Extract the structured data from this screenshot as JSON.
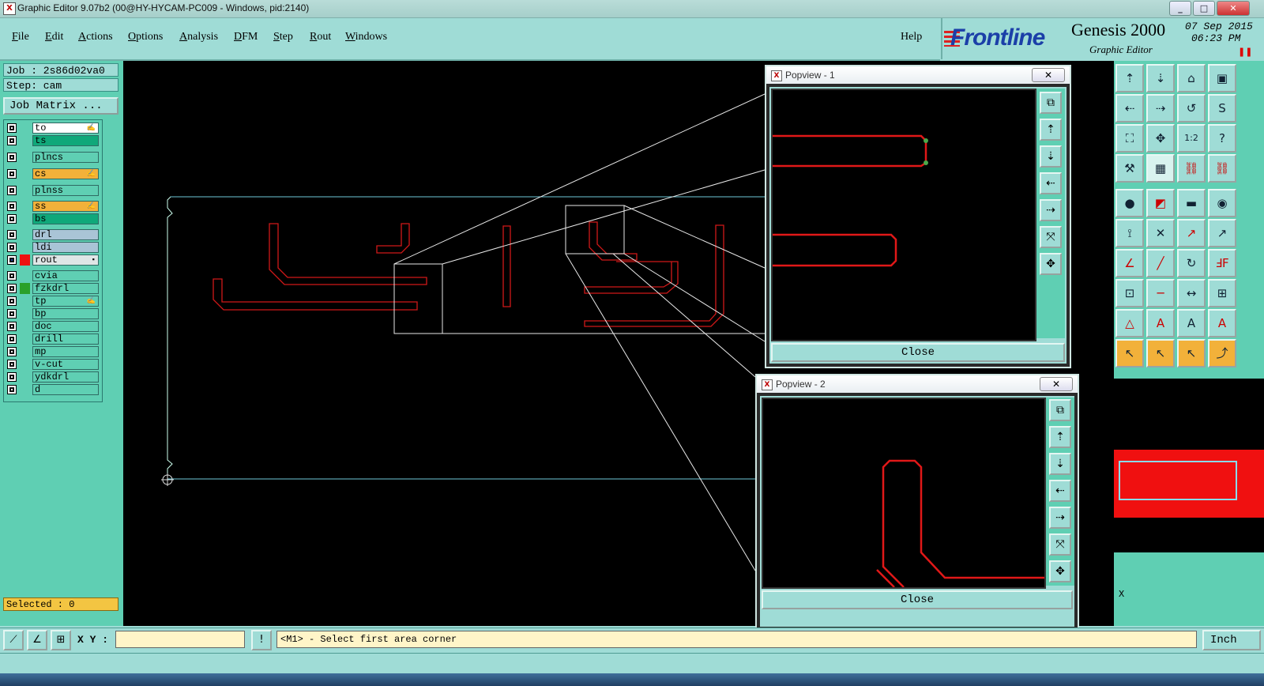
{
  "window": {
    "title": "Graphic Editor 9.07b2 (00@HY-HYCAM-PC009 - Windows, pid:2140)",
    "app_icon": "x-app-icon",
    "controls": [
      "minimize-icon",
      "maximize-icon",
      "close-icon"
    ]
  },
  "menubar": {
    "items": [
      "File",
      "Edit",
      "Actions",
      "Options",
      "Analysis",
      "DFM",
      "Step",
      "Rout",
      "Windows"
    ],
    "help": "Help"
  },
  "branding": {
    "logo": "Frontline",
    "product": "Genesis 2000",
    "subtitle": "Graphic Editor",
    "date": "07 Sep 2015",
    "time": "06:23 PM",
    "pause_icon": "pause-icon"
  },
  "left_panel": {
    "job": "Job : 2s86d02va0",
    "step": "Step: cam",
    "job_matrix": "Job Matrix ...",
    "layers": [
      {
        "name": "to",
        "color": "",
        "bg": "#ffffff",
        "mark": "✍"
      },
      {
        "name": "ts",
        "color": "",
        "bg": "#10a87a",
        "mark": ""
      },
      {
        "name": "plncs",
        "color": "",
        "bg": "#5fcfb3",
        "mark": ""
      },
      {
        "name": "cs",
        "color": "",
        "bg": "#f2b13a",
        "mark": "✍"
      },
      {
        "name": "plnss",
        "color": "",
        "bg": "#5fcfb3",
        "mark": ""
      },
      {
        "name": "ss",
        "color": "",
        "bg": "#f2b13a",
        "mark": "✍"
      },
      {
        "name": "bs",
        "color": "",
        "bg": "#10a87a",
        "mark": ""
      },
      {
        "name": "drl",
        "color": "",
        "bg": "#a9c4d6",
        "mark": ""
      },
      {
        "name": "ldi",
        "color": "",
        "bg": "#a9c4d6",
        "mark": ""
      },
      {
        "name": "rout",
        "color": "#ee1111",
        "bg": "#dfe6e6",
        "mark": "▪",
        "active": true
      },
      {
        "name": "cvia",
        "color": "",
        "bg": "#5fcfb3",
        "mark": ""
      },
      {
        "name": "fzkdrl",
        "color": "#2aa02a",
        "bg": "#5fcfb3",
        "mark": ""
      },
      {
        "name": "tp",
        "color": "",
        "bg": "#5fcfb3",
        "mark": "✍"
      },
      {
        "name": "bp",
        "color": "",
        "bg": "#5fcfb3",
        "mark": ""
      },
      {
        "name": "doc",
        "color": "",
        "bg": "#5fcfb3",
        "mark": ""
      },
      {
        "name": "drill",
        "color": "",
        "bg": "#5fcfb3",
        "mark": ""
      },
      {
        "name": "mp",
        "color": "",
        "bg": "#5fcfb3",
        "mark": ""
      },
      {
        "name": "v-cut",
        "color": "",
        "bg": "#5fcfb3",
        "mark": ""
      },
      {
        "name": "ydkdrl",
        "color": "",
        "bg": "#5fcfb3",
        "mark": ""
      },
      {
        "name": "d",
        "color": "",
        "bg": "#5fcfb3",
        "mark": ""
      }
    ],
    "selected": "Selected : 0"
  },
  "popview1": {
    "title": "Popview - 1",
    "close_label": "Close",
    "buttons": [
      "zoom-fit-icon",
      "pan-up-icon",
      "pan-down-icon",
      "pan-left-icon",
      "pan-right-icon",
      "zoom-in-icon",
      "zoom-out-icon"
    ]
  },
  "popview2": {
    "title": "Popview - 2",
    "close_label": "Close",
    "buttons": [
      "zoom-fit-icon",
      "pan-up-icon",
      "pan-down-icon",
      "pan-left-icon",
      "pan-right-icon",
      "zoom-in-icon",
      "zoom-out-icon"
    ]
  },
  "toolbox": {
    "rows": [
      [
        {
          "icon": "pan-up-icon",
          "glyph": "⇡"
        },
        {
          "icon": "pan-down-icon",
          "glyph": "⇣"
        },
        {
          "icon": "home-icon",
          "glyph": "⌂"
        },
        {
          "icon": "window-icon",
          "glyph": "▣"
        }
      ],
      [
        {
          "icon": "pan-left-icon",
          "glyph": "⇠"
        },
        {
          "icon": "pan-right-icon",
          "glyph": "⇢"
        },
        {
          "icon": "redraw-icon",
          "glyph": "↺"
        },
        {
          "icon": "snap-icon",
          "glyph": "S"
        }
      ],
      [
        {
          "icon": "zoom-fit-icon",
          "glyph": "⛶"
        },
        {
          "icon": "zoom-center-icon",
          "glyph": "✥"
        },
        {
          "icon": "scale-1-2-icon",
          "glyph": "1:2"
        },
        {
          "icon": "help-icon",
          "glyph": "?"
        }
      ],
      [
        {
          "icon": "measure-icon",
          "glyph": "⚒"
        },
        {
          "icon": "grid-icon",
          "glyph": "▦",
          "highlight": true
        },
        {
          "icon": "net-red-icon",
          "glyph": "⛓",
          "red": true
        },
        {
          "icon": "net-dot-icon",
          "glyph": "⛓",
          "red": true
        }
      ],
      [
        {
          "icon": "pad-icon",
          "glyph": "●"
        },
        {
          "icon": "fill-icon",
          "glyph": "◩",
          "red": true
        },
        {
          "icon": "ruler-icon",
          "glyph": "▬"
        },
        {
          "icon": "circle-dot-icon",
          "glyph": "◉"
        }
      ],
      [
        {
          "icon": "node-icon",
          "glyph": "⟟"
        },
        {
          "icon": "delete-x-icon",
          "glyph": "✕"
        },
        {
          "icon": "line-red-icon",
          "glyph": "↗",
          "red": true
        },
        {
          "icon": "line-blue-icon",
          "glyph": "↗"
        }
      ],
      [
        {
          "icon": "line-angle-icon",
          "glyph": "∠",
          "red": true
        },
        {
          "icon": "line-diag-icon",
          "glyph": "╱",
          "red": true
        },
        {
          "icon": "arc-icon",
          "glyph": "↻"
        },
        {
          "icon": "mirror-icon",
          "glyph": "ℲF",
          "red": true
        }
      ],
      [
        {
          "icon": "move-pad-icon",
          "glyph": "⊡"
        },
        {
          "icon": "hline-icon",
          "glyph": "─",
          "red": true
        },
        {
          "icon": "dimension-icon",
          "glyph": "↔"
        },
        {
          "icon": "pads-icon",
          "glyph": "⊞"
        }
      ],
      [
        {
          "icon": "triangle-a-icon",
          "glyph": "△",
          "red": true
        },
        {
          "icon": "triangle-b-icon",
          "glyph": "A",
          "red": true
        },
        {
          "icon": "triangle-c-icon",
          "glyph": "A"
        },
        {
          "icon": "triangle-d-icon",
          "glyph": "A",
          "red": true
        }
      ],
      [
        {
          "icon": "pointer-icon",
          "glyph": "↖",
          "yellow": true
        },
        {
          "icon": "pointer-select-icon",
          "glyph": "↖",
          "yellow": true
        },
        {
          "icon": "pointer-move-icon",
          "glyph": "↖",
          "yellow": true
        },
        {
          "icon": "pointer-route-icon",
          "glyph": "⤴",
          "yellow": true
        }
      ]
    ],
    "x_label": "X"
  },
  "statusbar": {
    "xy_label": "X Y :",
    "xy_value": "",
    "message": "<M1> - Select first area corner",
    "unit": "Inch",
    "buttons": [
      "snap-mode-icon",
      "angle-mode-icon",
      "grid-mode-icon"
    ],
    "alert_icon": "alert-icon"
  }
}
